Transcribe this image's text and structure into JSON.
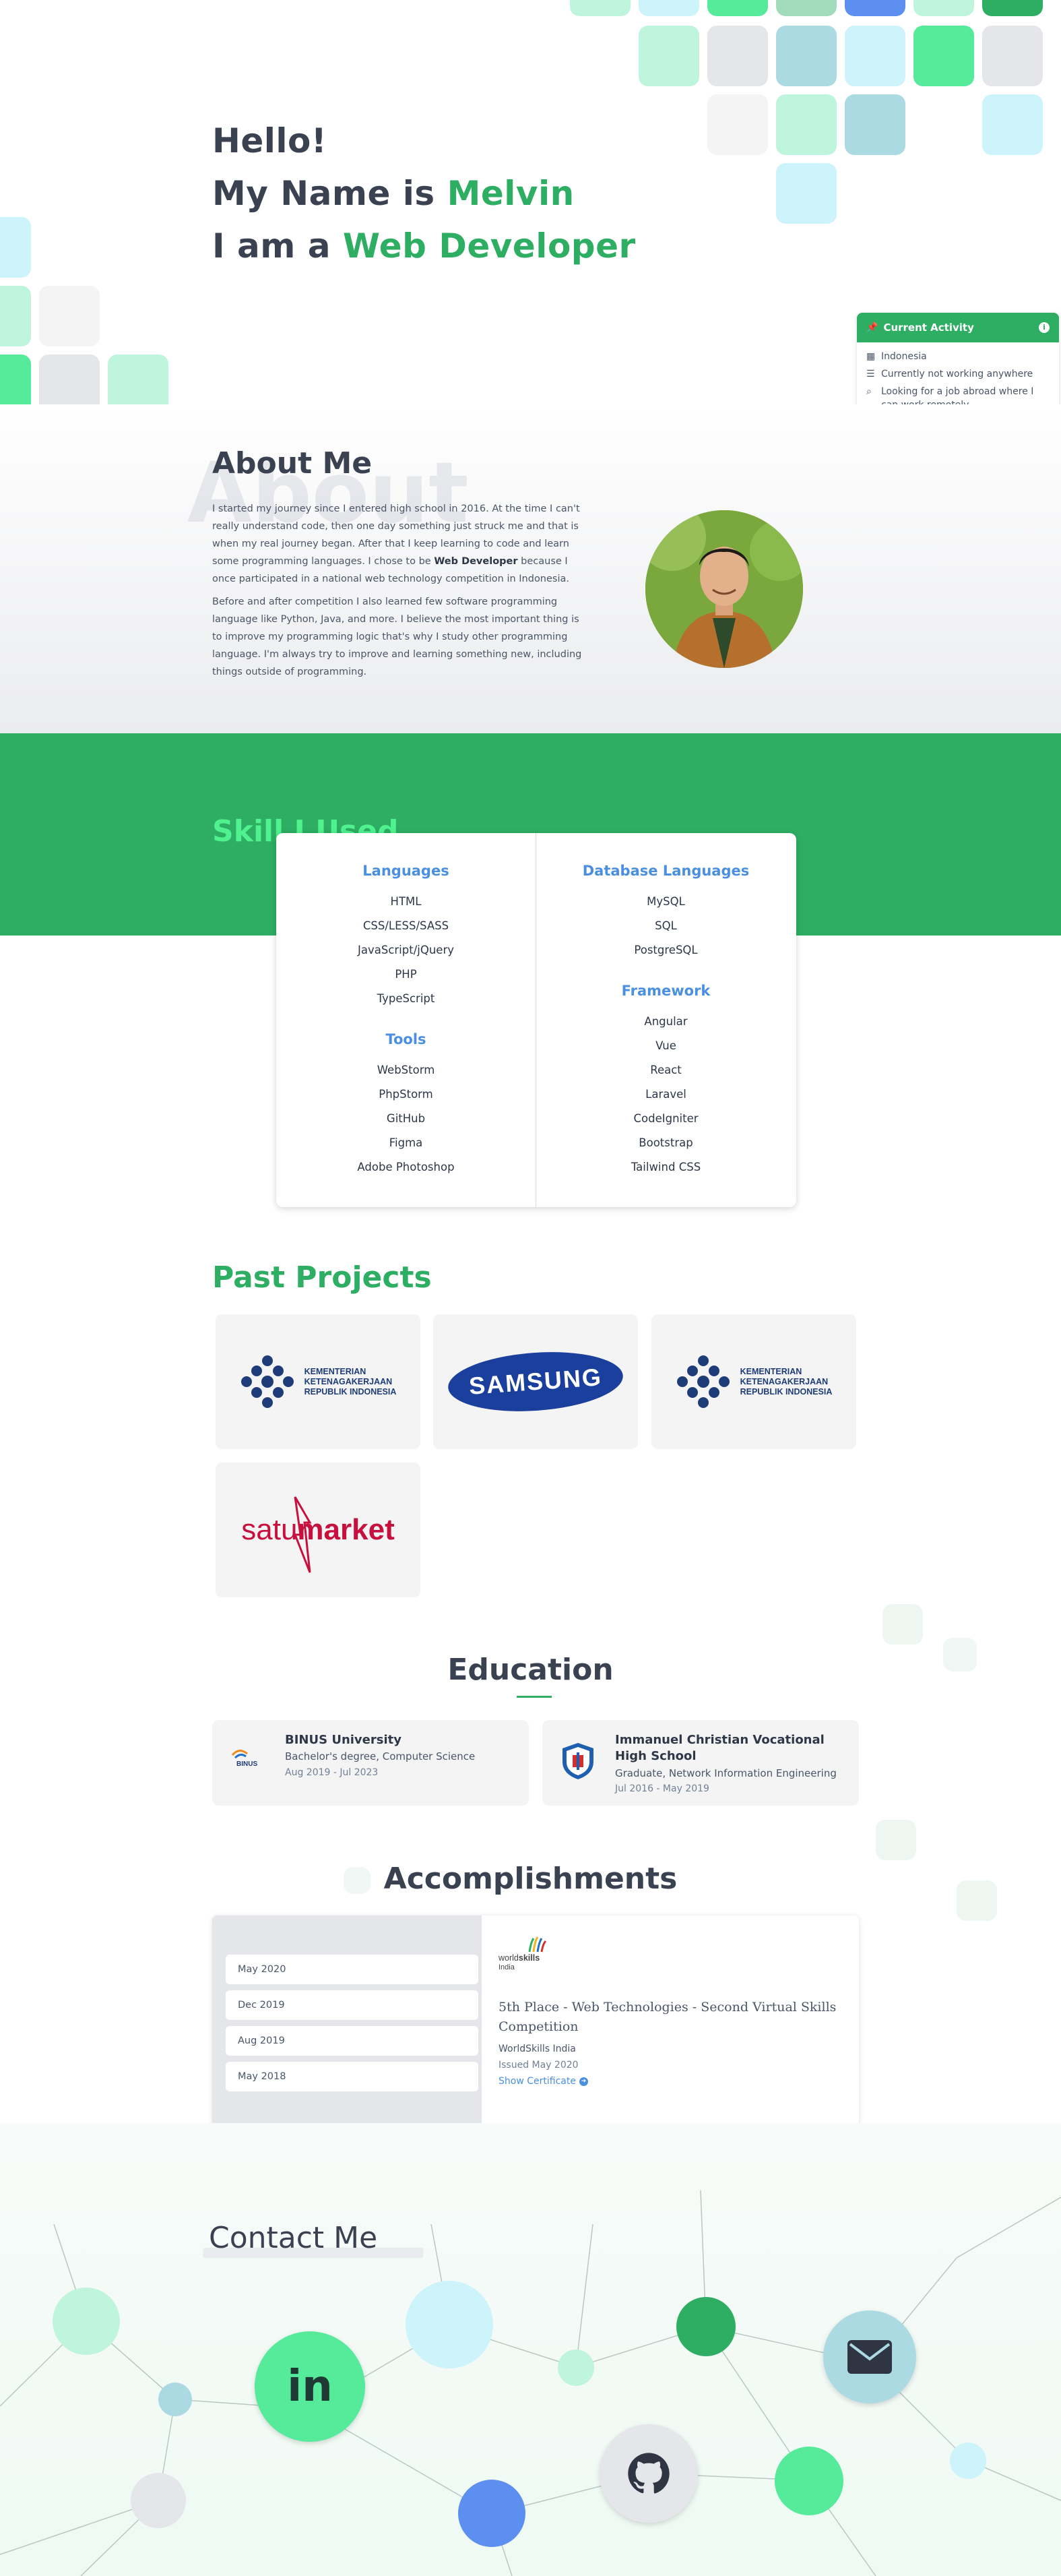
{
  "hero": {
    "line1": "Hello!",
    "line2_prefix": "My Name is ",
    "line2_name": "Melvin",
    "line3_prefix": "I am a ",
    "line3_role": "Web Developer"
  },
  "activity": {
    "title": "Current Activity",
    "items": [
      {
        "icon": "buildings-icon",
        "text": "Indonesia"
      },
      {
        "icon": "list-icon",
        "text": "Currently not working anywhere"
      },
      {
        "icon": "search-icon",
        "text": "Looking for a job abroad where I can work remotely"
      }
    ]
  },
  "about": {
    "ghost": "About",
    "title": "About Me",
    "p1_before": "I started my journey since I entered high school in 2016. At the time I can't really understand code, then one day something just struck me and that is when my real journey began. After that I keep learning to code and learn some programming languages. I chose to be ",
    "p1_bold": "Web Developer",
    "p1_after": " because I once participated in a national web technology competition in Indonesia.",
    "p2": "Before and after competition I also learned few software programming language like Python, Java, and more. I believe the most important thing is to improve my programming logic that's why I study other programming language. I'm always try to improve and learning something new, including things outside of programming."
  },
  "skills": {
    "title": "Skill I Used",
    "left": [
      {
        "heading": "Languages",
        "items": [
          "HTML",
          "CSS/LESS/SASS",
          "JavaScript/jQuery",
          "PHP",
          "TypeScript"
        ]
      },
      {
        "heading": "Tools",
        "items": [
          "WebStorm",
          "PhpStorm",
          "GitHub",
          "Figma",
          "Adobe Photoshop"
        ]
      }
    ],
    "right": [
      {
        "heading": "Database Languages",
        "items": [
          "MySQL",
          "SQL",
          "PostgreSQL"
        ]
      },
      {
        "heading": "Framework",
        "items": [
          "Angular",
          "Vue",
          "React",
          "Laravel",
          "CodeIgniter",
          "Bootstrap",
          "Tailwind CSS"
        ]
      }
    ]
  },
  "projects": {
    "title": "Past Projects",
    "kemnaker_lines": [
      "KEMENTERIAN",
      "KETENAGAKERJAAN",
      "REPUBLIK INDONESIA"
    ],
    "samsung": "SAMSUNG",
    "satu": "satu",
    "market": "market"
  },
  "education": {
    "title": "Education",
    "items": [
      {
        "school": "BINUS University",
        "degree": "Bachelor's degree, Computer Science",
        "dates": "Aug 2019 - Jul 2023",
        "logo_text": "BINUS"
      },
      {
        "school": "Immanuel Christian Vocational High School",
        "degree": "Graduate, Network Information Engineering",
        "dates": "Jul 2016 - May 2019"
      }
    ]
  },
  "accomplishments": {
    "title": "Accomplishments",
    "dates": [
      "May 2020",
      "Dec 2019",
      "Aug 2019",
      "May 2018"
    ],
    "logo_world": "world",
    "logo_skills": "skills",
    "logo_india": "India",
    "detail_title": "5th Place - Web Technologies - Second Virtual Skills Competition",
    "issuer": "WorldSkills India",
    "issued": "Issued May 2020",
    "link": "Show Certificate"
  },
  "contact": {
    "title": "Contact Me",
    "linkedin": "in"
  },
  "colors": {
    "accent": "#2dae63",
    "link": "#4a8fe0",
    "text": "#3a4252"
  }
}
